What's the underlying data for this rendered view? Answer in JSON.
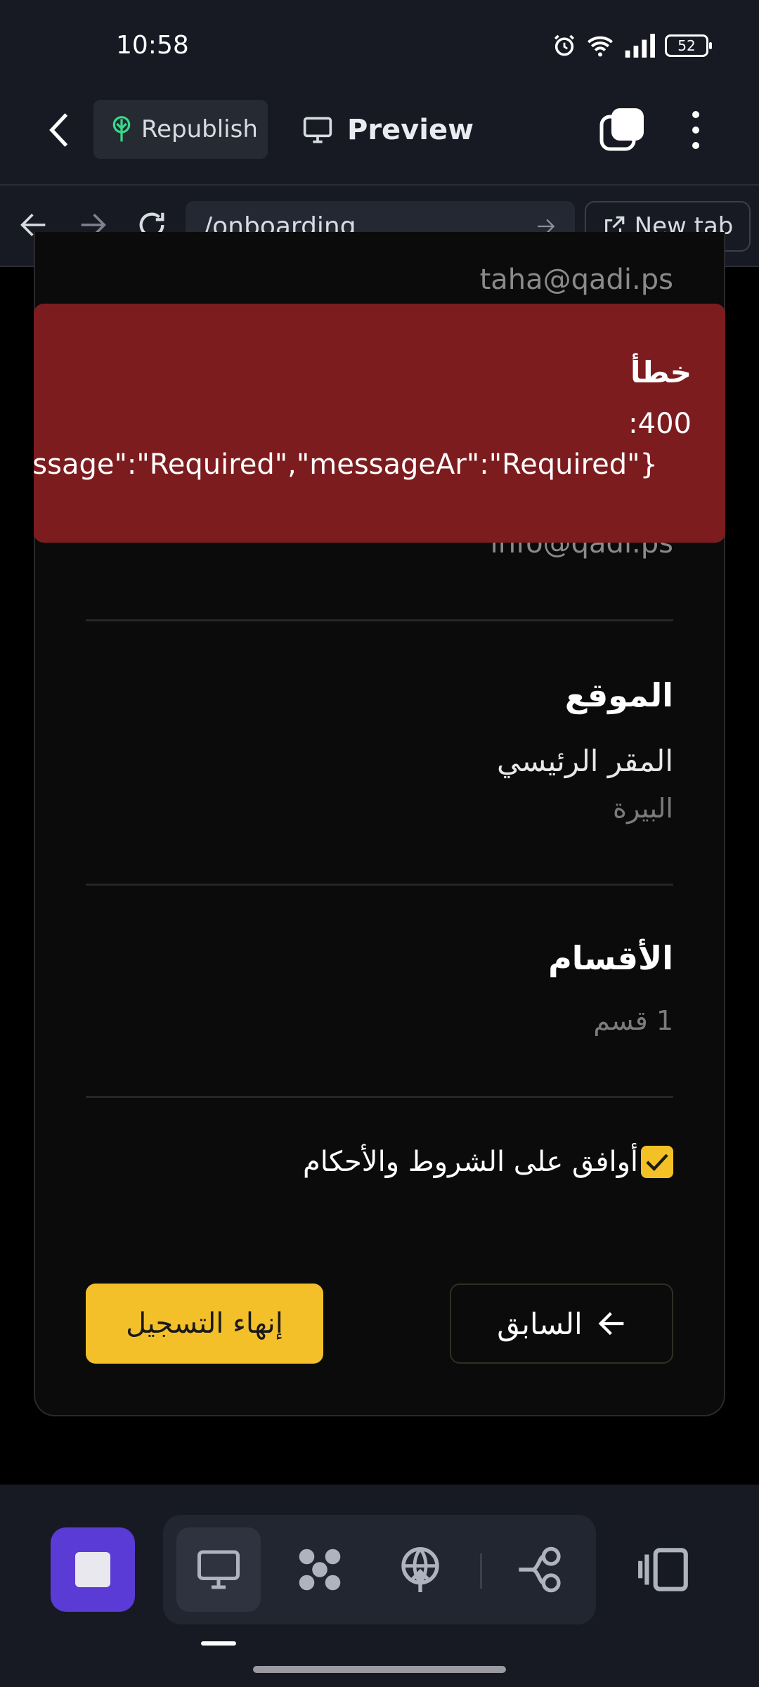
{
  "status_bar": {
    "time": "10:58",
    "battery": "52"
  },
  "app_bar": {
    "republish_label": "Republish",
    "preview_label": "Preview"
  },
  "browser": {
    "url": "/onboarding",
    "new_tab_label": "New tab"
  },
  "page": {
    "email_primary": "taha@qadi.ps",
    "email_secondary": "info@qadi.ps",
    "location": {
      "title": "الموقع",
      "name": "المقر الرئيسي",
      "city": "البيرة"
    },
    "departments": {
      "title": "الأقسام",
      "count_text": "1 قسم"
    },
    "terms_label": "أوافق على الشروط والأحكام",
    "terms_checked": true,
    "previous_button": "السابق",
    "finish_button": "إنهاء التسجيل"
  },
  "toast": {
    "title": "خطأ",
    "code": "400:",
    "message": "{\"message\":\"Required\",\"messageAr\":\"Required\"}"
  },
  "colors": {
    "accent_yellow": "#f4c02a",
    "error_red": "#7d1c1e",
    "stop_purple": "#5b3bd6"
  }
}
